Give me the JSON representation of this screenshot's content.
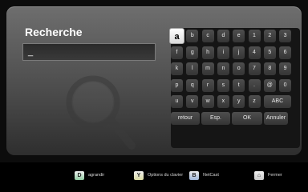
{
  "search": {
    "title": "Recherche",
    "input_value": "_"
  },
  "keyboard": {
    "rows": [
      [
        "a",
        "b",
        "c",
        "d",
        "e",
        "1",
        "2",
        "3"
      ],
      [
        "f",
        "g",
        "h",
        "i",
        "j",
        "4",
        "5",
        "6"
      ],
      [
        "k",
        "l",
        "m",
        "n",
        "o",
        "7",
        "8",
        "9"
      ],
      [
        "p",
        "q",
        "r",
        "s",
        "t",
        ".",
        "@",
        "0"
      ],
      [
        "u",
        "v",
        "w",
        "x",
        "y",
        "z",
        "ABC"
      ]
    ],
    "bottom_row": [
      "retour",
      "Esp.",
      "OK",
      "Annuler"
    ],
    "active_key": "a"
  },
  "footer": {
    "hints": [
      {
        "icon": "D",
        "label": "agrandir",
        "icon_name": "green-d-button-icon"
      },
      {
        "icon": "Y",
        "label": "Options du clavier",
        "icon_name": "yellow-y-button-icon"
      },
      {
        "icon": "B",
        "label": "NetCast",
        "icon_name": "blue-b-button-icon"
      },
      {
        "icon": "⌂",
        "label": "Fermer",
        "icon_name": "home-button-icon"
      }
    ]
  }
}
